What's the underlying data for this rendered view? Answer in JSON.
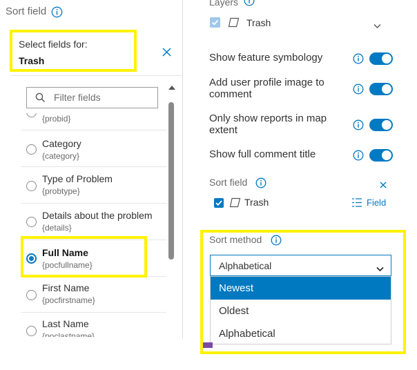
{
  "left": {
    "header_label": "Sort field",
    "select_for_label": "Select fields for:",
    "layer_name": "Trash",
    "filter_placeholder": "Filter fields",
    "partial_code": "{probid}",
    "fields": [
      {
        "label": "Category",
        "code": "{category}",
        "selected": false
      },
      {
        "label": "Type of Problem",
        "code": "{probtype}",
        "selected": false
      },
      {
        "label": "Details about the problem",
        "code": "{details}",
        "selected": false
      },
      {
        "label": "Full Name",
        "code": "{pocfullname}",
        "selected": true
      },
      {
        "label": "First Name",
        "code": "{pocfirstname}",
        "selected": false
      },
      {
        "label": "Last Name",
        "code": "{poclastname}",
        "selected": false
      }
    ]
  },
  "right": {
    "layers_label": "Layers",
    "layer_name": "Trash",
    "toggles": [
      {
        "label_lines": [
          "Show feature symbology"
        ],
        "on": true
      },
      {
        "label_lines": [
          "Add user profile image to",
          "comment"
        ],
        "on": true
      },
      {
        "label_lines": [
          "Only show reports in map",
          "extent"
        ],
        "on": true
      },
      {
        "label_lines": [
          "Show full comment title"
        ],
        "on": true
      }
    ],
    "sort_field_label": "Sort field",
    "sort_field_layer": "Trash",
    "field_button": "Field",
    "sort_method_label": "Sort method",
    "sort_method_value": "Alphabetical",
    "options": [
      "Newest",
      "Oldest",
      "Alphabetical"
    ],
    "highlighted_option": "Newest"
  },
  "colors": {
    "accent": "#007ac2",
    "highlight": "#fff200",
    "selected_option": "#0079c1"
  }
}
